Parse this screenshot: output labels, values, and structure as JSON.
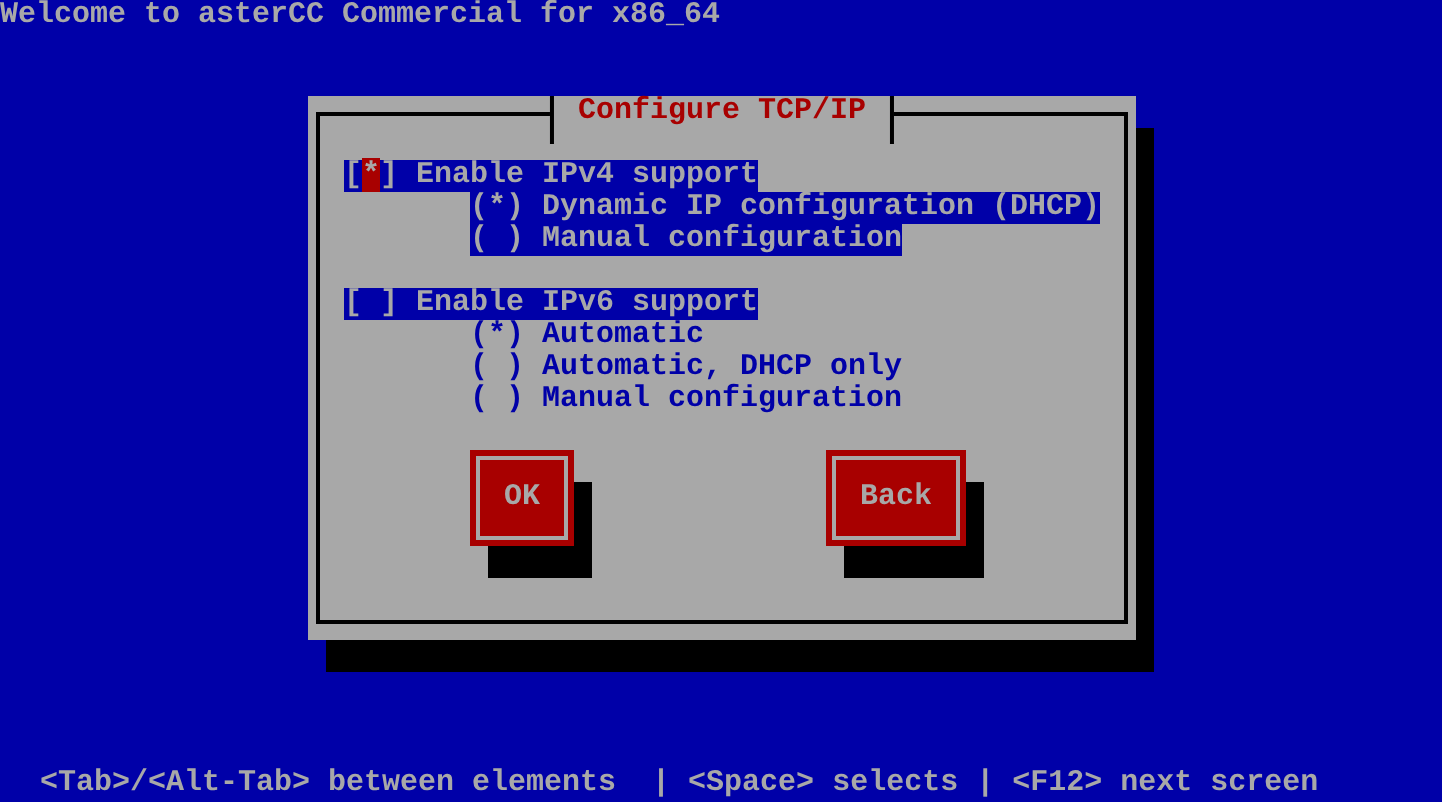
{
  "window": {
    "title": "Welcome to asterCC Commercial for x86_64"
  },
  "glyphs": {
    "box_open": "[",
    "box_close": "]",
    "check": "*",
    "radio_on": "(*)",
    "radio_off": "( )"
  },
  "dialog": {
    "title": "Configure TCP/IP",
    "groups": [
      {
        "checkbox": {
          "label": "Enable IPv4 support",
          "checked": true,
          "focused": true
        },
        "options": [
          {
            "label": "Dynamic IP configuration (DHCP)",
            "selected": true
          },
          {
            "label": "Manual configuration",
            "selected": false
          }
        ]
      },
      {
        "checkbox": {
          "label": "Enable IPv6 support",
          "checked": false,
          "focused": false
        },
        "options": [
          {
            "label": "Automatic",
            "selected": true
          },
          {
            "label": "Automatic, DHCP only",
            "selected": false
          },
          {
            "label": "Manual configuration",
            "selected": false
          }
        ]
      }
    ],
    "buttons": [
      {
        "label": "OK"
      },
      {
        "label": "Back"
      }
    ]
  },
  "status_bar": "<Tab>/<Alt-Tab> between elements  | <Space> selects | <F12> next screen"
}
